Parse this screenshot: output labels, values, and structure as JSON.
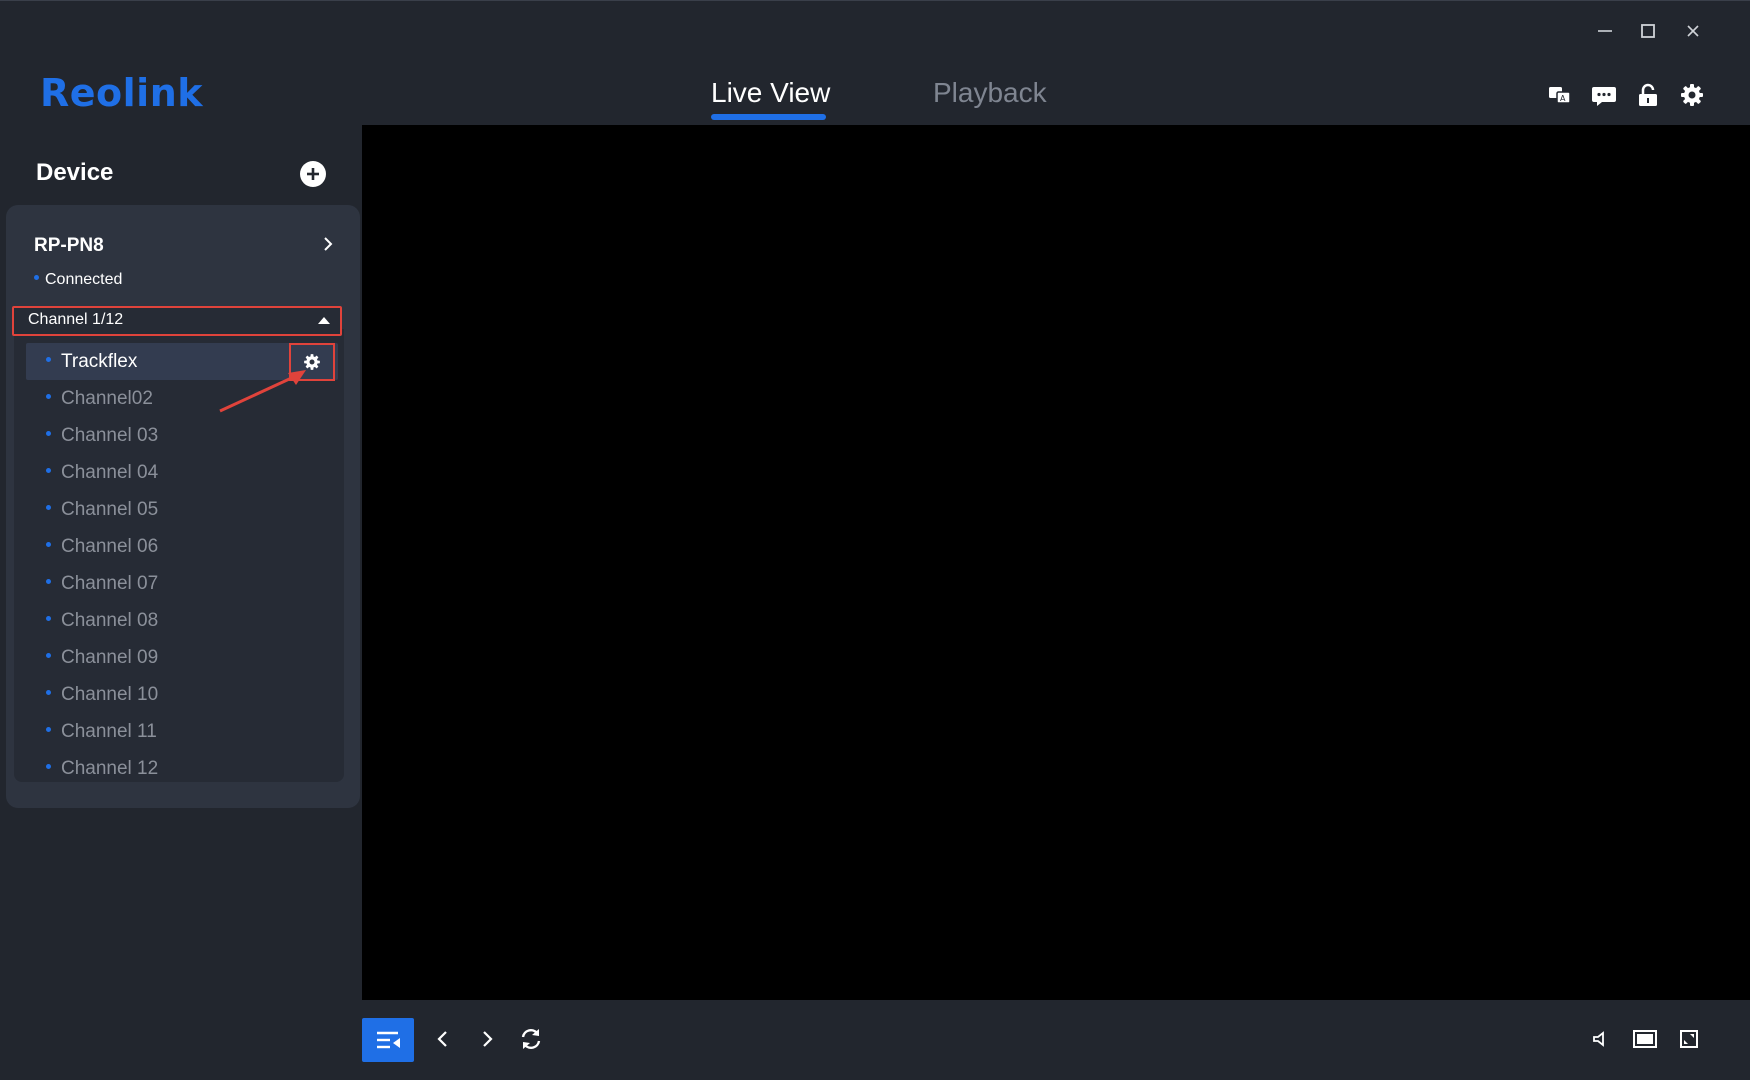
{
  "app": {
    "logo": "Reolink",
    "accent_color": "#1f6fe6",
    "highlight_color": "#e0433b"
  },
  "window_controls": {
    "minimize": "minimize-icon",
    "maximize": "maximize-icon",
    "close": "close-icon"
  },
  "tabs": [
    {
      "label": "Live View",
      "active": true
    },
    {
      "label": "Playback",
      "active": false
    }
  ],
  "header_icons": [
    "translate-icon",
    "message-icon",
    "unlock-icon",
    "gear-icon"
  ],
  "sidebar": {
    "title": "Device",
    "device": {
      "name": "RP-PN8",
      "status": "Connected"
    },
    "channel_group": {
      "label": "Channel 1/12",
      "expanded": true
    },
    "channels": [
      {
        "label": "Trackflex",
        "selected": true
      },
      {
        "label": "Channel02",
        "selected": false
      },
      {
        "label": "Channel 03",
        "selected": false
      },
      {
        "label": "Channel 04",
        "selected": false
      },
      {
        "label": "Channel 05",
        "selected": false
      },
      {
        "label": "Channel 06",
        "selected": false
      },
      {
        "label": "Channel 07",
        "selected": false
      },
      {
        "label": "Channel 08",
        "selected": false
      },
      {
        "label": "Channel 09",
        "selected": false
      },
      {
        "label": "Channel 10",
        "selected": false
      },
      {
        "label": "Channel 11",
        "selected": false
      },
      {
        "label": "Channel 12",
        "selected": false
      }
    ]
  },
  "bottom_bar": {
    "left_icons": [
      "collapse-list-icon",
      "chevron-left-icon",
      "chevron-right-icon",
      "refresh-icon"
    ],
    "right_icons": [
      "volume-icon",
      "single-screen-icon",
      "fullscreen-icon"
    ]
  }
}
